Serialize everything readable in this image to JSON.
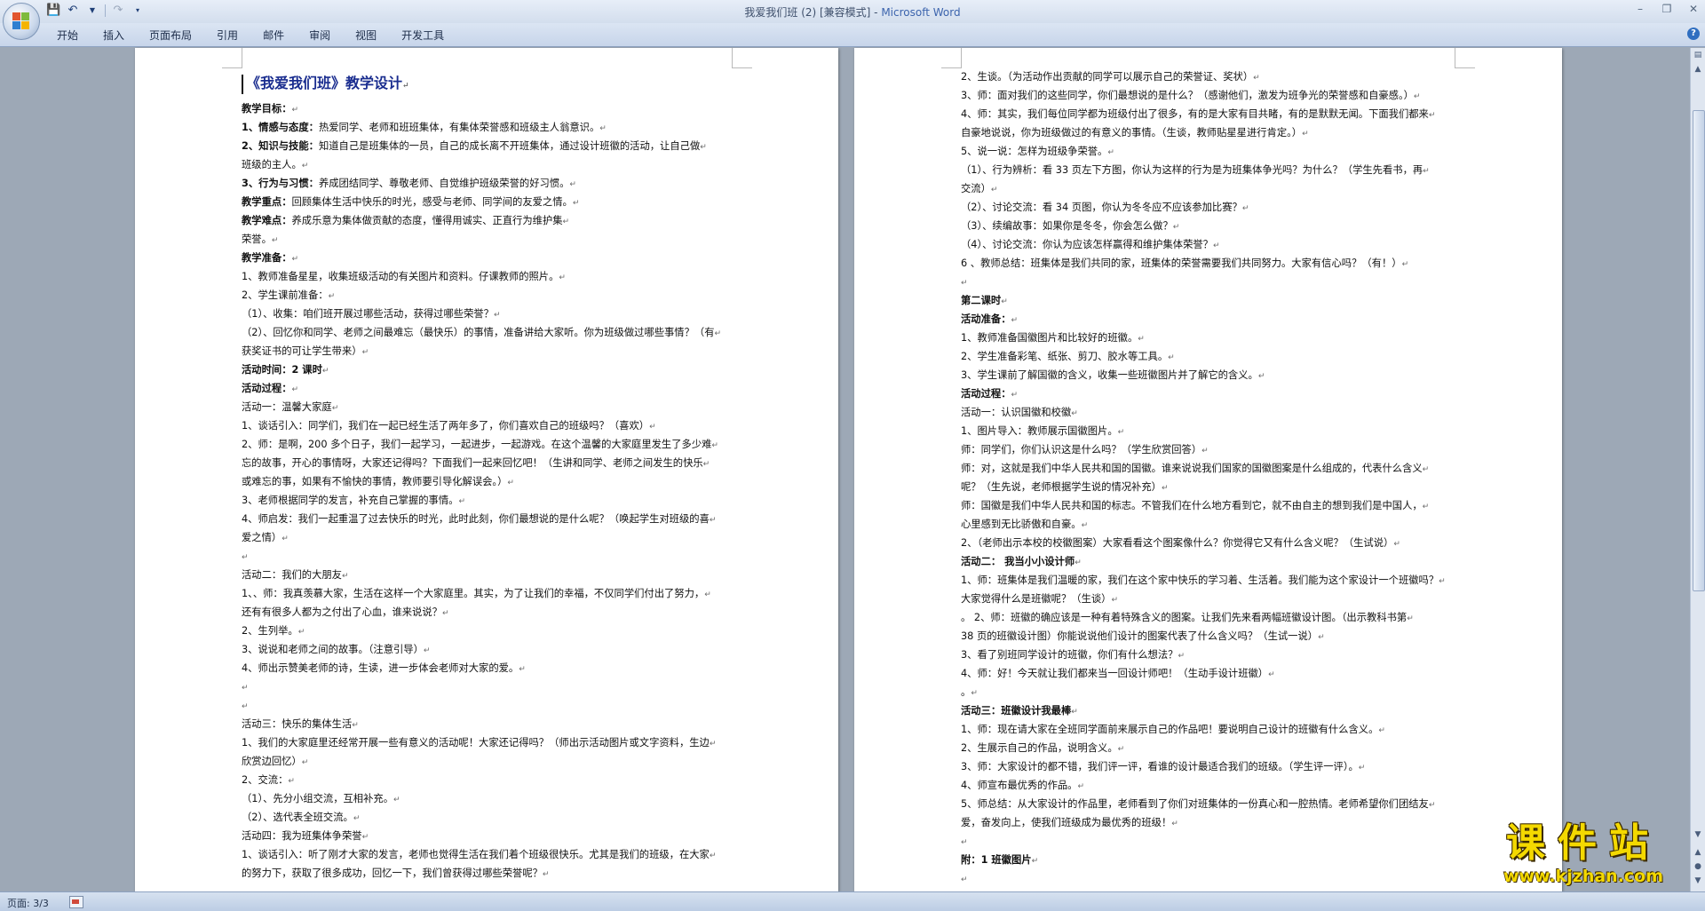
{
  "window": {
    "title_doc": "我爱我们班 (2) [兼容模式] - ",
    "title_app": "Microsoft Word"
  },
  "ribbon": {
    "tabs": [
      "开始",
      "插入",
      "页面布局",
      "引用",
      "邮件",
      "审阅",
      "视图",
      "开发工具"
    ]
  },
  "status": {
    "page": "页面: 3/3"
  },
  "watermark": {
    "main": "课件站",
    "url": "www.kjzhan.com"
  },
  "left_page": [
    {
      "text": "《我爱我们班》教学设计",
      "style": "title"
    },
    {
      "bold": "教学目标：",
      "text": ""
    },
    {
      "bold": "1、情感与态度：",
      "text": "热爱同学、老师和班班集体，有集体荣誉感和班级主人翁意识。"
    },
    {
      "bold": "2、知识与技能：",
      "text": "知道自己是班集体的一员，自己的成长离不开班集体，通过设计班徽的活动，让自己做"
    },
    {
      "text": "班级的主人。"
    },
    {
      "bold": "3、行为与习惯：",
      "text": "养成团结同学、尊敬老师、自觉维护班级荣誉的好习惯。"
    },
    {
      "bold": "教学重点：",
      "text": "回顾集体生活中快乐的时光，感受与老师、同学间的友爱之情。"
    },
    {
      "bold": "教学难点：",
      "text": "养成乐意为集体做贡献的态度，懂得用诚实、正直行为维护集"
    },
    {
      "text": "荣誉。"
    },
    {
      "bold": "教学准备：",
      "text": ""
    },
    {
      "text": "1、教师准备星星，收集班级活动的有关图片和资料。仔课教师的照片。"
    },
    {
      "text": "2、学生课前准备："
    },
    {
      "text": "（1）、收集：咱们班开展过哪些活动，获得过哪些荣誉？"
    },
    {
      "text": "（2）、回忆你和同学、老师之间最难忘（最快乐）的事情，准备讲给大家听。你为班级做过哪些事情？（有"
    },
    {
      "text": "获奖证书的可让学生带来）"
    },
    {
      "bold": "活动时间：2 课时",
      "text": ""
    },
    {
      "bold": "活动过程：",
      "text": ""
    },
    {
      "text": "活动一：温馨大家庭"
    },
    {
      "text": "1、谈话引入：同学们，我们在一起已经生活了两年多了，你们喜欢自己的班级吗？（喜欢）"
    },
    {
      "text": "2、师：是啊，200 多个日子，我们一起学习，一起进步，一起游戏。在这个温馨的大家庭里发生了多少难"
    },
    {
      "text": "忘的故事，开心的事情呀，大家还记得吗？下面我们一起来回忆吧！（生讲和同学、老师之间发生的快乐"
    },
    {
      "text": "或难忘的事，如果有不愉快的事情，教师要引导化解误会。）"
    },
    {
      "text": "3、老师根据同学的发言，补充自己掌握的事情。"
    },
    {
      "text": "4、师启发：我们一起重温了过去快乐的时光，此时此刻，你们最想说的是什么呢？（唤起学生对班级的喜"
    },
    {
      "text": "爱之情）"
    },
    {
      "text": ""
    },
    {
      "text": "活动二：我们的大朋友"
    },
    {
      "text": "1、、师：我真羡慕大家，生活在这样一个大家庭里。其实，为了让我们的幸福，不仅同学们付出了努力，"
    },
    {
      "text": "还有有很多人都为之付出了心血，谁来说说？"
    },
    {
      "text": "2、生列举。"
    },
    {
      "text": "3、说说和老师之间的故事。（注意引导）"
    },
    {
      "text": "4、师出示赞美老师的诗，生读，进一步体会老师对大家的爱。"
    },
    {
      "text": ""
    },
    {
      "text": ""
    },
    {
      "text": "活动三：快乐的集体生活"
    },
    {
      "text": "1、我们的大家庭里还经常开展一些有意义的活动呢！大家还记得吗？（师出示活动图片或文字资料，生边"
    },
    {
      "text": "欣赏边回忆）"
    },
    {
      "text": "2、交流："
    },
    {
      "text": "（1）、先分小组交流，互相补充。"
    },
    {
      "text": "（2）、选代表全班交流。"
    },
    {
      "text": "活动四：我为班集体争荣誉"
    },
    {
      "text": "1、谈话引入：听了刚才大家的发言，老师也觉得生活在我们着个班级很快乐。尤其是我们的班级，在大家"
    },
    {
      "text": "的努力下，获取了很多成功，回忆一下，我们曾获得过哪些荣誉呢？"
    }
  ],
  "right_page": [
    {
      "text": "2、生谈。（为活动作出贡献的同学可以展示自己的荣誉证、奖状）"
    },
    {
      "text": "3、师：面对我们的这些同学，你们最想说的是什么？（感谢他们，激发为班争光的荣誉感和自豪感。）"
    },
    {
      "text": "4、师：其实，我们每位同学都为班级付出了很多，有的是大家有目共睹，有的是默默无闻。下面我们都来"
    },
    {
      "text": "自豪地说说，你为班级做过的有意义的事情。（生谈，教师贴星星进行肯定。）"
    },
    {
      "text": "5、说一说：怎样为班级争荣誉。"
    },
    {
      "text": "（1）、行为辨析：看 33 页左下方图，你认为这样的行为是为班集体争光吗？为什么？（学生先看书，再"
    },
    {
      "text": "交流）"
    },
    {
      "text": "（2）、讨论交流：看 34 页图，你认为冬冬应不应该参加比赛？"
    },
    {
      "text": "（3）、续编故事：如果你是冬冬，你会怎么做？"
    },
    {
      "text": "（4）、讨论交流：你认为应该怎样赢得和维护集体荣誉？"
    },
    {
      "text": "6 、教师总结：班集体是我们共同的家，班集体的荣誉需要我们共同努力。大家有信心吗？（有！）"
    },
    {
      "text": ""
    },
    {
      "bold": "第二课时",
      "text": ""
    },
    {
      "bold": "活动准备：",
      "text": ""
    },
    {
      "text": "1、教师准备国徽图片和比较好的班徽。"
    },
    {
      "text": "2、学生准备彩笔、纸张、剪刀、胶水等工具。"
    },
    {
      "text": "3、学生课前了解国徽的含义，收集一些班徽图片并了解它的含义。"
    },
    {
      "bold": "活动过程：",
      "text": ""
    },
    {
      "text": "活动一：认识国徽和校徽"
    },
    {
      "text": "1、图片导入：教师展示国徽图片。"
    },
    {
      "text": "师：同学们，你们认识这是什么吗？（学生欣赏回答）"
    },
    {
      "text": "师：对，这就是我们中华人民共和国的国徽。谁来说说我们国家的国徽图案是什么组成的，代表什么含义"
    },
    {
      "text": "呢？（生先说，老师根据学生说的情况补充）"
    },
    {
      "text": " 师：国徽是我们中华人民共和国的标志。不管我们在什么地方看到它，就不由自主的想到我们是中国人，"
    },
    {
      "text": "心里感到无比骄傲和自豪。"
    },
    {
      "text": "2、（老师出示本校的校徽图案）大家看看这个图案像什么？你觉得它又有什么含义呢？（生试说）"
    },
    {
      "bold": "活动二：  我当小小设计师",
      "text": ""
    },
    {
      "text": "1、师：班集体是我们温暖的家，我们在这个家中快乐的学习着、生活着。我们能为这个家设计一个班徽吗？"
    },
    {
      "text": "大家觉得什么是班徽呢？（生谈）"
    },
    {
      "text": "。  2、师：班徽的确应该是一种有着特殊含义的图案。让我们先来看两幅班徽设计图。（出示教科书第"
    },
    {
      "text": "38 页的班徽设计图）你能说说他们设计的图案代表了什么含义吗？（生试一说）"
    },
    {
      "text": "3、看了别班同学设计的班徽，你们有什么想法？"
    },
    {
      "text": "4、师：好！今天就让我们都来当一回设计师吧！（生动手设计班徽）"
    },
    {
      "text": "。"
    },
    {
      "bold": "活动三：班徽设计我最棒",
      "text": ""
    },
    {
      "text": "1、师：现在请大家在全班同学面前来展示自己的作品吧！要说明自己设计的班徽有什么含义。"
    },
    {
      "text": "2、生展示自己的作品，说明含义。"
    },
    {
      "text": "3、师：大家设计的都不错，我们评一评，看谁的设计最适合我们的班级。（学生评一评）。"
    },
    {
      "text": "4、师宣布最优秀的作品。"
    },
    {
      "text": "5、师总结：从大家设计的作品里，老师看到了你们对班集体的一份真心和一腔热情。老师希望你们团结友"
    },
    {
      "text": "爱，奋发向上，使我们班级成为最优秀的班级！"
    },
    {
      "text": ""
    },
    {
      "bold": "    附：1 班徽图片",
      "text": ""
    },
    {
      "text": ""
    }
  ]
}
